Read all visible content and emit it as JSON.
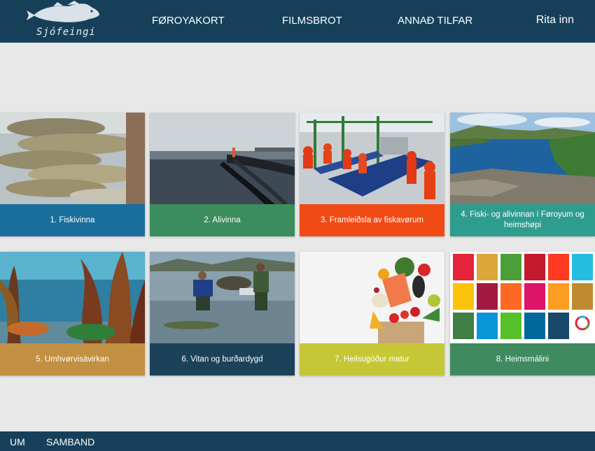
{
  "header": {
    "logo_text": "Sjófeingi",
    "nav": [
      "FØROYAKORT",
      "FILMSBROT",
      "ANNAÐ TILFAR"
    ],
    "login": "Rita inn"
  },
  "tiles": [
    {
      "label": "1. Fiskivinna",
      "color": "#1a6e9c",
      "image": "fish-on-ice"
    },
    {
      "label": "2. Alivinna",
      "color": "#3c8d5e",
      "image": "fish-farm-pen"
    },
    {
      "label": "3. Framleiðsla av fiskavørum",
      "color": "#f04b15",
      "image": "fish-factory"
    },
    {
      "label": "4. Fiski- og alivinnan í Føroyum og heimshøpi",
      "color": "#2e9d90",
      "image": "faroe-landscape"
    },
    {
      "label": "5. Umhvørvisávirkan",
      "color": "#c19043",
      "image": "kelp-forest"
    },
    {
      "label": "6. Vitan og burðardygd",
      "color": "#1b4258",
      "image": "researchers-in-water"
    },
    {
      "label": "7. Heilsugóður matur",
      "color": "#c6c736",
      "image": "healthy-food"
    },
    {
      "label": "8. Heimsmálini",
      "color": "#3f8b5f",
      "image": "sdg-goals"
    }
  ],
  "footer": {
    "links": [
      "UM",
      "SAMBAND"
    ]
  }
}
